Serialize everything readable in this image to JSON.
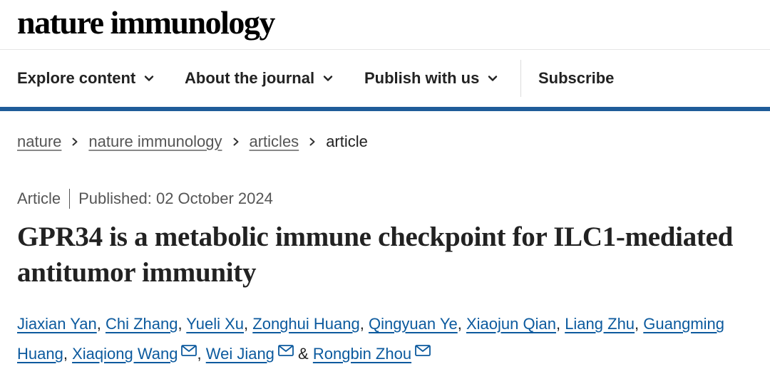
{
  "site": {
    "logo": "nature immunology"
  },
  "nav": {
    "explore": "Explore content",
    "about": "About the journal",
    "publish": "Publish with us",
    "subscribe": "Subscribe",
    "chevron_icon": "chevron-down-icon"
  },
  "breadcrumb": {
    "items": [
      "nature",
      "nature immunology",
      "articles"
    ],
    "current": "article",
    "separator_icon": "chevron-right-icon"
  },
  "article": {
    "type": "Article",
    "published": "Published: 02 October 2024",
    "title": "GPR34 is a metabolic immune checkpoint for ILC1-mediated antitumor immunity",
    "authors": [
      "Jiaxian Yan",
      "Chi Zhang",
      "Yueli Xu",
      "Zonghui Huang",
      "Qingyuan Ye",
      "Xiaojun Qian",
      "Liang Zhu",
      "Guangming Huang",
      "Xiaqiong Wang",
      "Wei Jiang",
      "Rongbin Zhou"
    ],
    "author_joiner": "&",
    "mail_icon": "mail-icon"
  },
  "colors": {
    "accent_bar": "#1f5c99",
    "link": "#0c5a9e",
    "text": "#222222",
    "muted": "#555555"
  }
}
